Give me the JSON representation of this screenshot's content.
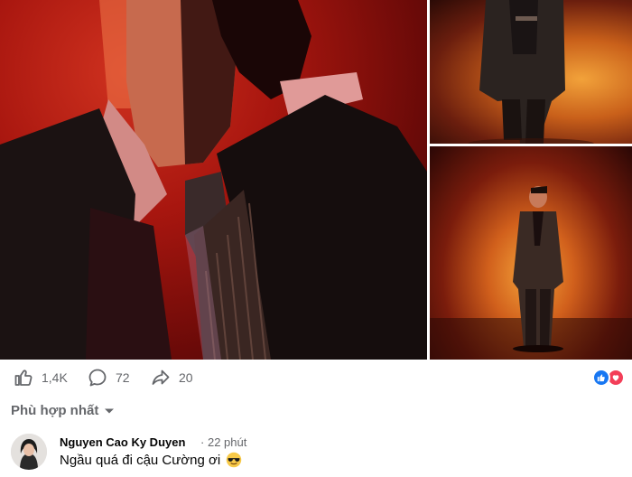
{
  "post": {
    "photos": [
      {
        "name": "main-portrait-photo"
      },
      {
        "name": "full-body-photo-top"
      },
      {
        "name": "full-body-photo-bottom"
      }
    ],
    "stats": {
      "likes": "1,4K",
      "comments": "72",
      "shares": "20",
      "like_icon": "thumbs-up-icon",
      "comment_icon": "speech-bubble-icon",
      "share_icon": "share-arrow-icon",
      "reaction_icons": [
        "like-reaction-icon",
        "love-reaction-icon"
      ]
    }
  },
  "comments_section": {
    "sort_label": "Phù hợp nhất",
    "sort_icon": "caret-down-icon",
    "comments": [
      {
        "author": "Nguyen Cao Ky Duyen",
        "separator": "·",
        "time": "22 phút",
        "text": "Ngầu quá đi cậu Cường ơi",
        "emoji_icon": "sunglasses-emoji-icon"
      }
    ]
  },
  "colors": {
    "accent_blue": "#1877f2",
    "love_red": "#f33e58",
    "muted_text": "#65676b",
    "text": "#050505"
  }
}
